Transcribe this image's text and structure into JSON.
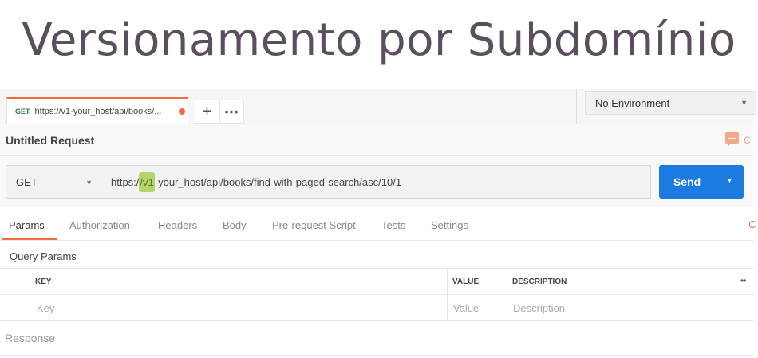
{
  "slide": {
    "title": "Versionamento por Subdomínio"
  },
  "tabbar": {
    "tab": {
      "method": "GET",
      "label": "https://v1-your_host/api/books/..."
    },
    "add_label": "+",
    "more_label": "•••"
  },
  "environment": {
    "selected": "No Environment"
  },
  "request": {
    "name": "Untitled Request",
    "comments_cut": "C"
  },
  "url_bar": {
    "method": "GET",
    "url_prefix": "https:/",
    "url_highlight": "/v1",
    "url_suffix": "-your_host/api/books/find-with-paged-search/asc/10/1",
    "send_label": "Send"
  },
  "request_tabs": [
    "Params",
    "Authorization",
    "Headers",
    "Body",
    "Pre-request Script",
    "Tests",
    "Settings"
  ],
  "cookies_cut": "C",
  "query_params": {
    "title": "Query Params",
    "headers": {
      "key": "KEY",
      "value": "VALUE",
      "description": "DESCRIPTION",
      "more": "••"
    },
    "placeholders": {
      "key": "Key",
      "value": "Value",
      "description": "Description"
    }
  },
  "response": {
    "label": "Response"
  },
  "colors": {
    "accent": "#f26b3a",
    "send": "#1b7be0",
    "highlight": "#b3d66b",
    "title": "#5a4f5c"
  }
}
